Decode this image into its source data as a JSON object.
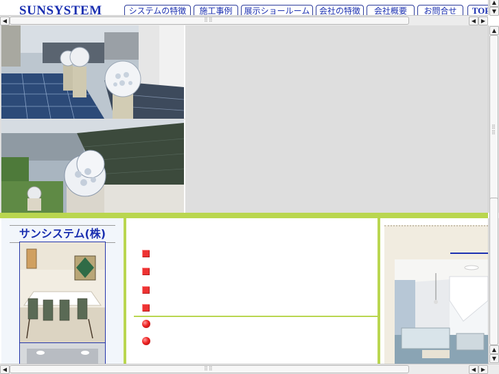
{
  "header": {
    "logo": "SUNSYSTEM",
    "nav": [
      {
        "label": "システムの特徴"
      },
      {
        "label": "施工事例"
      },
      {
        "label": "展示ショールーム"
      },
      {
        "label": "会社の特徴"
      },
      {
        "label": "会社概要"
      },
      {
        "label": "お問合せ"
      },
      {
        "label": "TOP"
      }
    ]
  },
  "sidebar": {
    "company_name": "サンシステム(株)"
  },
  "colors": {
    "accent_green": "#b9d64f",
    "link_blue": "#1a2fb0",
    "bullet_red": "#ee3333"
  },
  "icons": {
    "scroll_up": "▲",
    "scroll_down": "▼",
    "scroll_left": "◀",
    "scroll_right": "▶"
  }
}
